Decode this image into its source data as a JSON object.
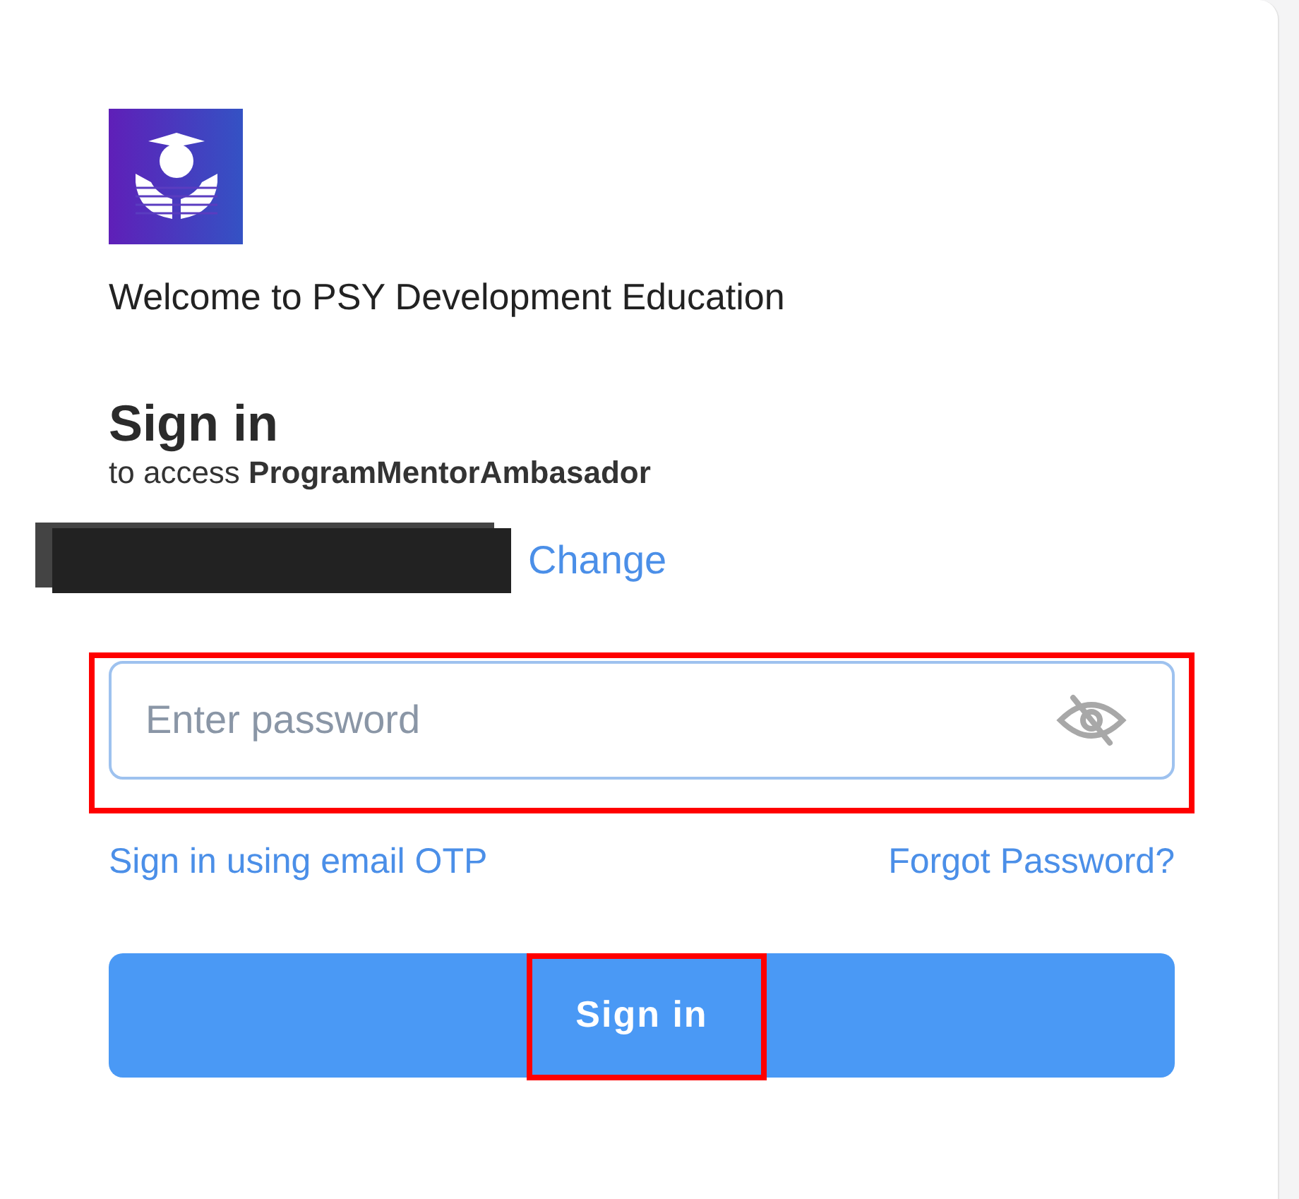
{
  "welcome": "Welcome to PSY Development Education",
  "heading": "Sign in",
  "subtitle": "to access **ProgramMentorAmbasador**",
  "account": {
    "redacted": true,
    "change_link": "Change"
  },
  "password": {
    "placeholder": "Enter password",
    "highlighted": true
  },
  "links": [
    "Sign in using email OTP",
    "Forgot Password?"
  ],
  "submit": {
    "label": "Sign in",
    "highlighted": true
  }
}
